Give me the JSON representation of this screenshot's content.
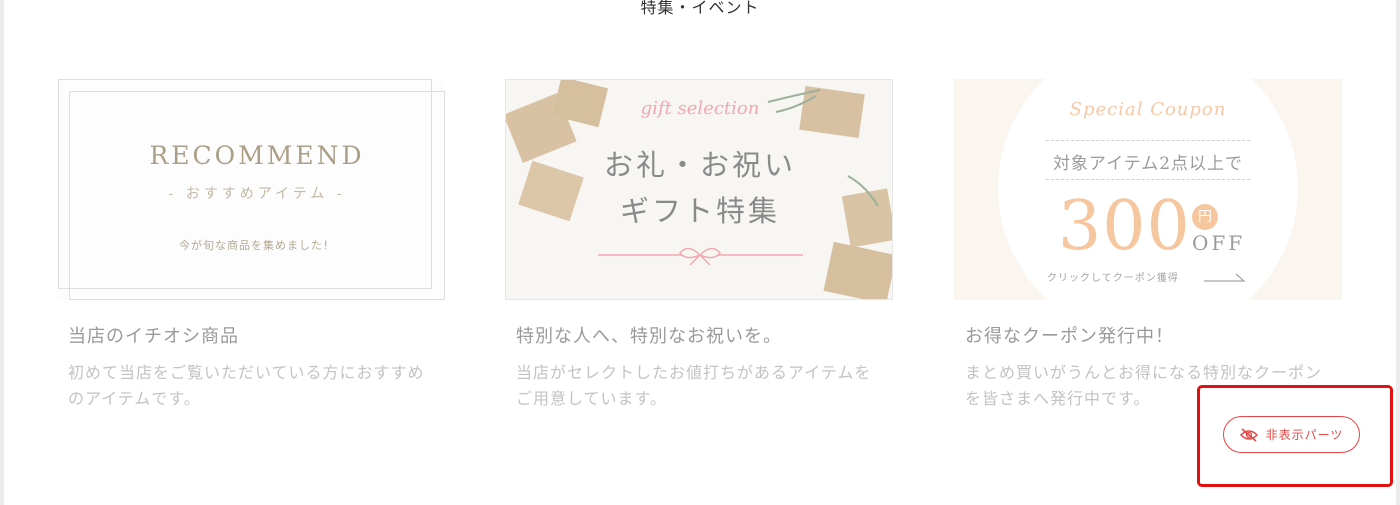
{
  "section": {
    "title": "特集・イベント"
  },
  "cards": [
    {
      "banner": {
        "title": "RECOMMEND",
        "subtitle": "- おすすめアイテム -",
        "note": "今が旬な商品を集めました！"
      },
      "title": "当店のイチオシ商品",
      "description": "初めて当店をご覧いただいている方におすすめのアイテムです。"
    },
    {
      "banner": {
        "script": "gift selection",
        "line1": "お礼・お祝い",
        "line2": "ギフト特集"
      },
      "title": "特別な人へ、特別なお祝いを。",
      "description": "当店がセレクトしたお値打ちがあるアイテムをご用意しています。"
    },
    {
      "banner": {
        "script": "Special Coupon",
        "condition": "対象アイテム2点以上で",
        "amount": "300",
        "yen": "円",
        "off": "OFF",
        "click": "クリックしてクーポン獲得"
      },
      "title": "お得なクーポン発行中！",
      "description": "まとめ買いがうんとお得になる特別なクーポンを皆さまへ発行中です。"
    }
  ],
  "hidden_badge": {
    "label": "非表示パーツ",
    "icon": "eye-slash-icon",
    "color": "#e64545"
  },
  "highlight": {
    "color": "#e0110f"
  }
}
